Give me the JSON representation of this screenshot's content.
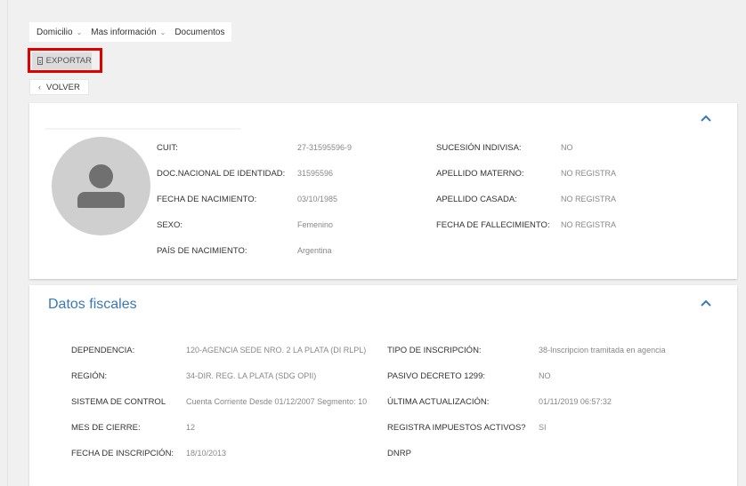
{
  "top_menu": {
    "items": [
      {
        "label": "Domicilio",
        "has_dropdown": true
      },
      {
        "label": "Mas información",
        "has_dropdown": true
      },
      {
        "label": "Documentos",
        "has_dropdown": false
      }
    ]
  },
  "toolbar": {
    "export_label": "EXPORTAR",
    "back_label": "VOLVER"
  },
  "personal": {
    "cuit": {
      "label": "CUIT:",
      "value": "27-31595596-9"
    },
    "doc": {
      "label": "DOC.NACIONAL DE IDENTIDAD:",
      "value": "31595596"
    },
    "birth": {
      "label": "FECHA DE NACIMIENTO:",
      "value": "03/10/1985"
    },
    "sex": {
      "label": "SEXO:",
      "value": "Femenino"
    },
    "country": {
      "label": "PAÍS DE NACIMIENTO:",
      "value": "Argentina"
    },
    "succession": {
      "label": "SUCESIÓN INDIVISA:",
      "value": "NO"
    },
    "maternal": {
      "label": "APELLIDO MATERNO:",
      "value": "NO REGISTRA"
    },
    "married": {
      "label": "APELLIDO CASADA:",
      "value": "NO REGISTRA"
    },
    "death": {
      "label": "FECHA DE FALLECIMIENTO:",
      "value": "NO REGISTRA"
    }
  },
  "fiscal": {
    "title": "Datos fiscales",
    "dependency": {
      "label": "DEPENDENCIA:",
      "value": "120-AGENCIA SEDE NRO. 2 LA PLATA (DI RLPL)"
    },
    "region": {
      "label": "REGIÓN:",
      "value": "34-DIR. REG. LA PLATA (SDG OPII)"
    },
    "control": {
      "label": "SISTEMA DE CONTROL",
      "value": "Cuenta Corriente Desde 01/12/2007 Segmento: 10"
    },
    "closing": {
      "label": "MES DE CIERRE:",
      "value": "12"
    },
    "inscription_date": {
      "label": "FECHA DE INSCRIPCIÓN:",
      "value": "18/10/2013"
    },
    "inscription_type": {
      "label": "TIPO DE INSCRIPCIÓN:",
      "value": "38-Inscripcion tramitada en agencia"
    },
    "decree": {
      "label": "PASIVO DECRETO 1299:",
      "value": "NO"
    },
    "update": {
      "label": "ÚLTIMA ACTUALIZACIÓN:",
      "value": "01/11/2019 06:57:32"
    },
    "taxes": {
      "label": "REGISTRA IMPUESTOS ACTIVOS?",
      "value": "SI"
    },
    "dnrp": {
      "label": "DNRP"
    }
  },
  "colors": {
    "accent": "#3a78b8",
    "highlight": "#e10000",
    "background": "#f0f0f0"
  },
  "icons": [
    "chevron-down-icon",
    "document-icon",
    "chevron-left-icon",
    "chevron-up-icon",
    "person-avatar-icon"
  ]
}
